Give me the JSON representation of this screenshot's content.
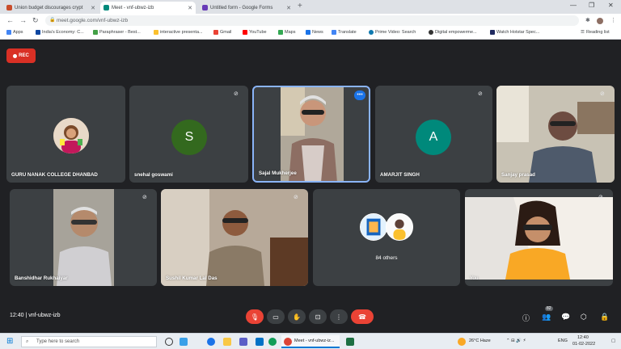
{
  "browser": {
    "tabs": [
      {
        "title": "Union budget discourages crypt",
        "active": false,
        "color": "#c94d2c"
      },
      {
        "title": "Meet - vnf-ubwz-izb",
        "active": true,
        "color": "#00897b"
      },
      {
        "title": "Untitled form - Google Forms",
        "active": false,
        "color": "#673ab7"
      }
    ],
    "new_tab": "+",
    "url": "meet.google.com/vnf-ubwz-izb",
    "bookmarks": [
      "Apps",
      "India's Economy: C...",
      "Paraphraser - Best...",
      "interactive presenta...",
      "Gmail",
      "YouTube",
      "Maps",
      "News",
      "Translate",
      "Prime Video: Search",
      "Digital empowerme...",
      "Watch Hotstar Spec..."
    ],
    "reading_list": "Reading list"
  },
  "meet": {
    "rec_label": "REC",
    "tiles": [
      {
        "name": "GURU NANAK COLLEGE DHANBAD"
      },
      {
        "name": "snehal goswami",
        "initial": "S",
        "color": "#33691e"
      },
      {
        "name": "Sajal Mukherjee"
      },
      {
        "name": "AMARJIT SINGH",
        "initial": "A",
        "color": "#00897b"
      },
      {
        "name": "Sanjay prasad"
      },
      {
        "name": "Banshidhar Rukhaiyar"
      },
      {
        "name": "Sushil Kumar Lal Das"
      },
      {
        "name": "84 others"
      },
      {
        "name": "You"
      }
    ],
    "time": "12:40",
    "separator": "|",
    "meeting_code": "vnf-ubwz-izb",
    "participant_count": "82"
  },
  "taskbar": {
    "search_placeholder": "Type here to search",
    "active_app": "Meet - vnf-ubwz-iz...",
    "weather": "26°C Haze",
    "lang": "ENG",
    "clock_time": "12:40",
    "clock_date": "01-02-2022"
  }
}
